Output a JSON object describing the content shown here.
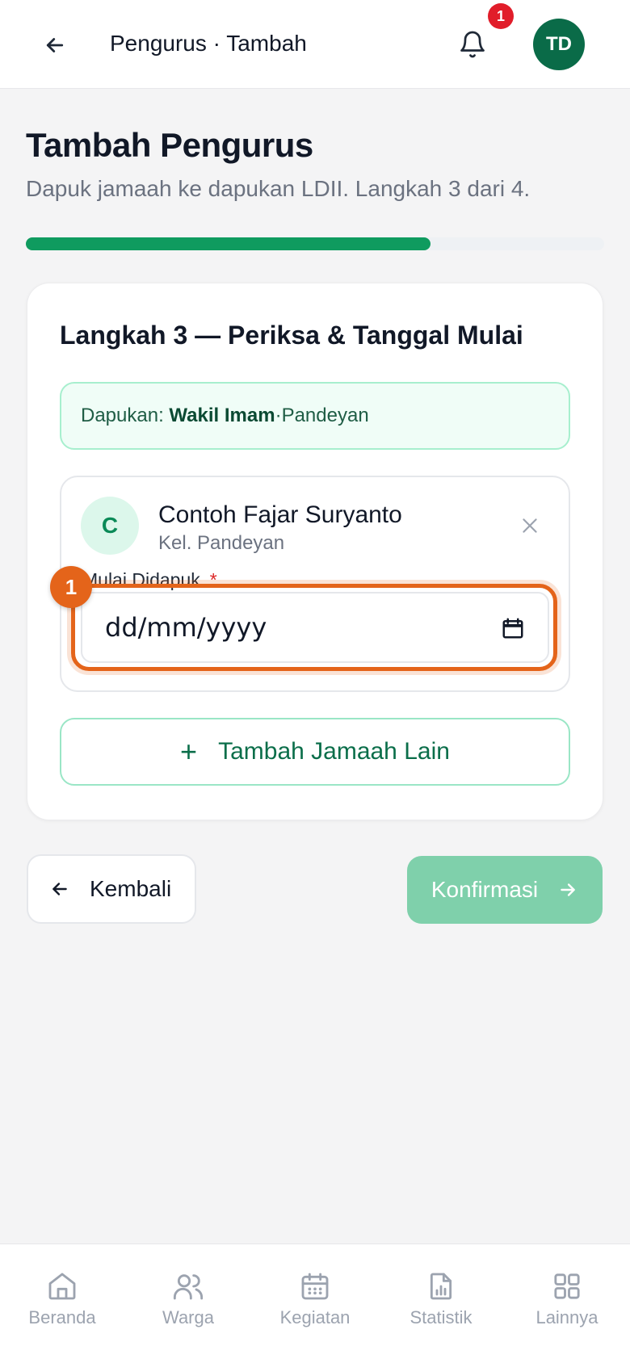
{
  "header": {
    "title": "Pengurus · Tambah",
    "notification_count": "1",
    "avatar_initials": "TD"
  },
  "page": {
    "title": "Tambah Pengurus",
    "subtitle": "Dapuk jamaah ke dapukan LDII. Langkah 3 dari 4.",
    "progress": {
      "current_step": 3,
      "total_steps": 4,
      "fraction": 0.7
    }
  },
  "card": {
    "step_title": "Langkah 3 — Periksa & Tanggal Mulai",
    "dapukan": {
      "label": "Dapukan:",
      "role": "Wakil Imam",
      "separator": " · ",
      "location": "Pandeyan"
    },
    "person": {
      "initial": "C",
      "name": "Contoh Fajar Suryanto",
      "kelompok": "Kel. Pandeyan"
    },
    "field": {
      "label": "Mulai Didapuk",
      "required_mark": "*",
      "placeholder": "dd/mm/yyyy",
      "marker_number": "1"
    },
    "add_button_label": "Tambah Jamaah Lain"
  },
  "actions": {
    "back_label": "Kembali",
    "confirm_label": "Konfirmasi"
  },
  "nav": [
    {
      "label": "Beranda",
      "icon": "home-icon"
    },
    {
      "label": "Warga",
      "icon": "users-icon"
    },
    {
      "label": "Kegiatan",
      "icon": "calendar-icon"
    },
    {
      "label": "Statistik",
      "icon": "chart-file-icon"
    },
    {
      "label": "Lainnya",
      "icon": "grid-icon"
    }
  ],
  "colors": {
    "primary": "#0f9b5f",
    "primary_dark": "#0a6b48",
    "highlight": "#e4641a",
    "badge": "#e11d2a",
    "confirm_disabled": "#7fd0ab"
  }
}
